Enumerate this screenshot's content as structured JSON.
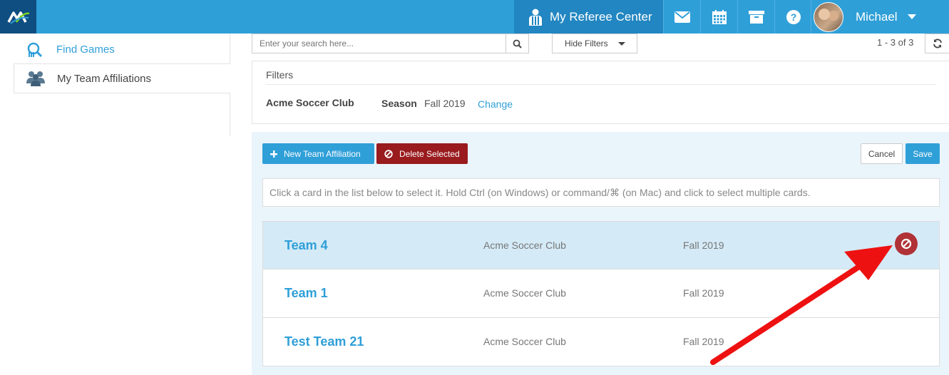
{
  "topbar": {
    "logo_icon": "mx-logo-icon",
    "referee_center_label": "My Referee Center",
    "icons": [
      "envelope-icon",
      "calendar-icon",
      "archive-icon",
      "help-icon"
    ],
    "user_name": "Michael",
    "colors": {
      "bar": "#2f9fd8",
      "active": "#2186c1",
      "logo_bg": "#0f4e80"
    }
  },
  "sidebar": {
    "items": [
      {
        "label": "Find Games",
        "icon": "find-games-icon",
        "active": false
      },
      {
        "label": "My Team Affiliations",
        "icon": "team-affiliations-icon",
        "active": true
      }
    ]
  },
  "search": {
    "placeholder": "Enter your search here...",
    "hide_filters_label": "Hide Filters",
    "pager_text": "1 - 3 of 3"
  },
  "filters": {
    "title": "Filters",
    "club": "Acme Soccer Club",
    "season_label": "Season",
    "season_value": "Fall 2019",
    "change_label": "Change"
  },
  "toolbar": {
    "new_label": "New Team Affiliation",
    "delete_label": "Delete Selected",
    "cancel_label": "Cancel",
    "save_label": "Save",
    "colors": {
      "primary": "#2f9fd8",
      "danger": "#991b1e"
    }
  },
  "hint": "Click a card in the list below to select it. Hold Ctrl (on Windows) or command/⌘ (on Mac) and click to select multiple cards.",
  "cards": [
    {
      "name": "Team 4",
      "club": "Acme Soccer Club",
      "season": "Fall 2019",
      "selected": true
    },
    {
      "name": "Team 1",
      "club": "Acme Soccer Club",
      "season": "Fall 2019",
      "selected": false
    },
    {
      "name": "Test Team 21",
      "club": "Acme Soccer Club",
      "season": "Fall 2019",
      "selected": false
    }
  ]
}
